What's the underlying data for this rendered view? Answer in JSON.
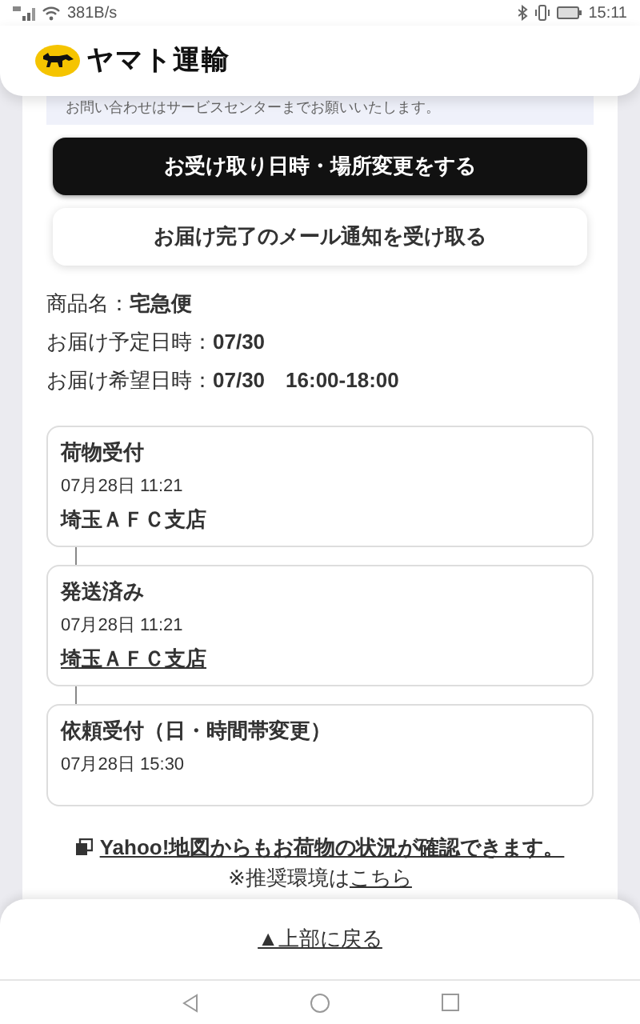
{
  "status_bar": {
    "network_speed": "381B/s",
    "time": "15:11"
  },
  "header": {
    "brand": "ヤマト運輸"
  },
  "notice": "お問い合わせはサービスセンターまでお願いいたします。",
  "buttons": [
    {
      "label": "お受け取り日時・場所変更をする",
      "kind": "primary"
    },
    {
      "label": "お届け完了のメール通知を受け取る",
      "kind": "secondary"
    }
  ],
  "details": [
    {
      "label": "商品名：",
      "value": "宅急便"
    },
    {
      "label": "お届け予定日時：",
      "value": "07/30"
    },
    {
      "label": "お届け希望日時：",
      "value": "07/30　16:00-18:00"
    }
  ],
  "timeline": [
    {
      "status": "荷物受付",
      "datetime": "07月28日 11:21",
      "location": "埼玉ＡＦＣ支店",
      "link": false
    },
    {
      "status": "発送済み",
      "datetime": "07月28日 11:21",
      "location": "埼玉ＡＦＣ支店",
      "link": true
    },
    {
      "status": "依頼受付（日・時間帯変更）",
      "datetime": "07月28日 15:30"
    }
  ],
  "map_link": "Yahoo!地図からもお荷物の状況が確認できます。",
  "recommend": {
    "prefix": "※推奨環境は",
    "link": "こちら"
  },
  "back_to_top": "▲上部に戻る"
}
